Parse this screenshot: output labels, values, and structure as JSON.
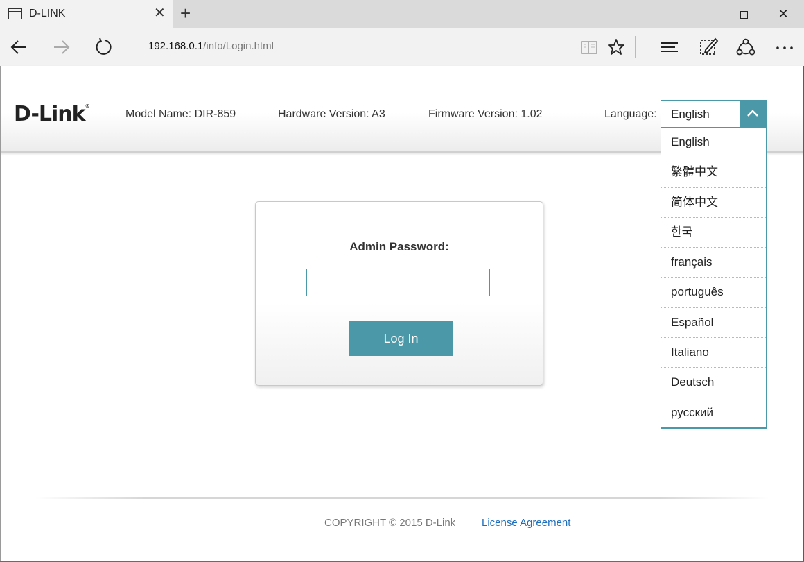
{
  "browser": {
    "tab_title": "D-LINK",
    "address_host": "192.168.0.1",
    "address_path": "/info/Login.html"
  },
  "header": {
    "logo": "D-Link",
    "logo_mark": "®",
    "model": "Model Name: DIR-859",
    "hardware": "Hardware Version: A3",
    "firmware": "Firmware Version: 1.02",
    "language_label": "Language:",
    "language_selected": "English"
  },
  "language_options": [
    "English",
    "繁體中文",
    "简体中文",
    "한국",
    "français",
    "português",
    "Español",
    "Italiano",
    "Deutsch",
    "русский"
  ],
  "login": {
    "label": "Admin Password:",
    "password_value": "",
    "button_label": "Log In"
  },
  "footer": {
    "copyright": "COPYRIGHT © 2015 D-Link",
    "license": "License Agreement"
  },
  "colors": {
    "accent": "#4a98a8",
    "link": "#1c6ebd"
  }
}
